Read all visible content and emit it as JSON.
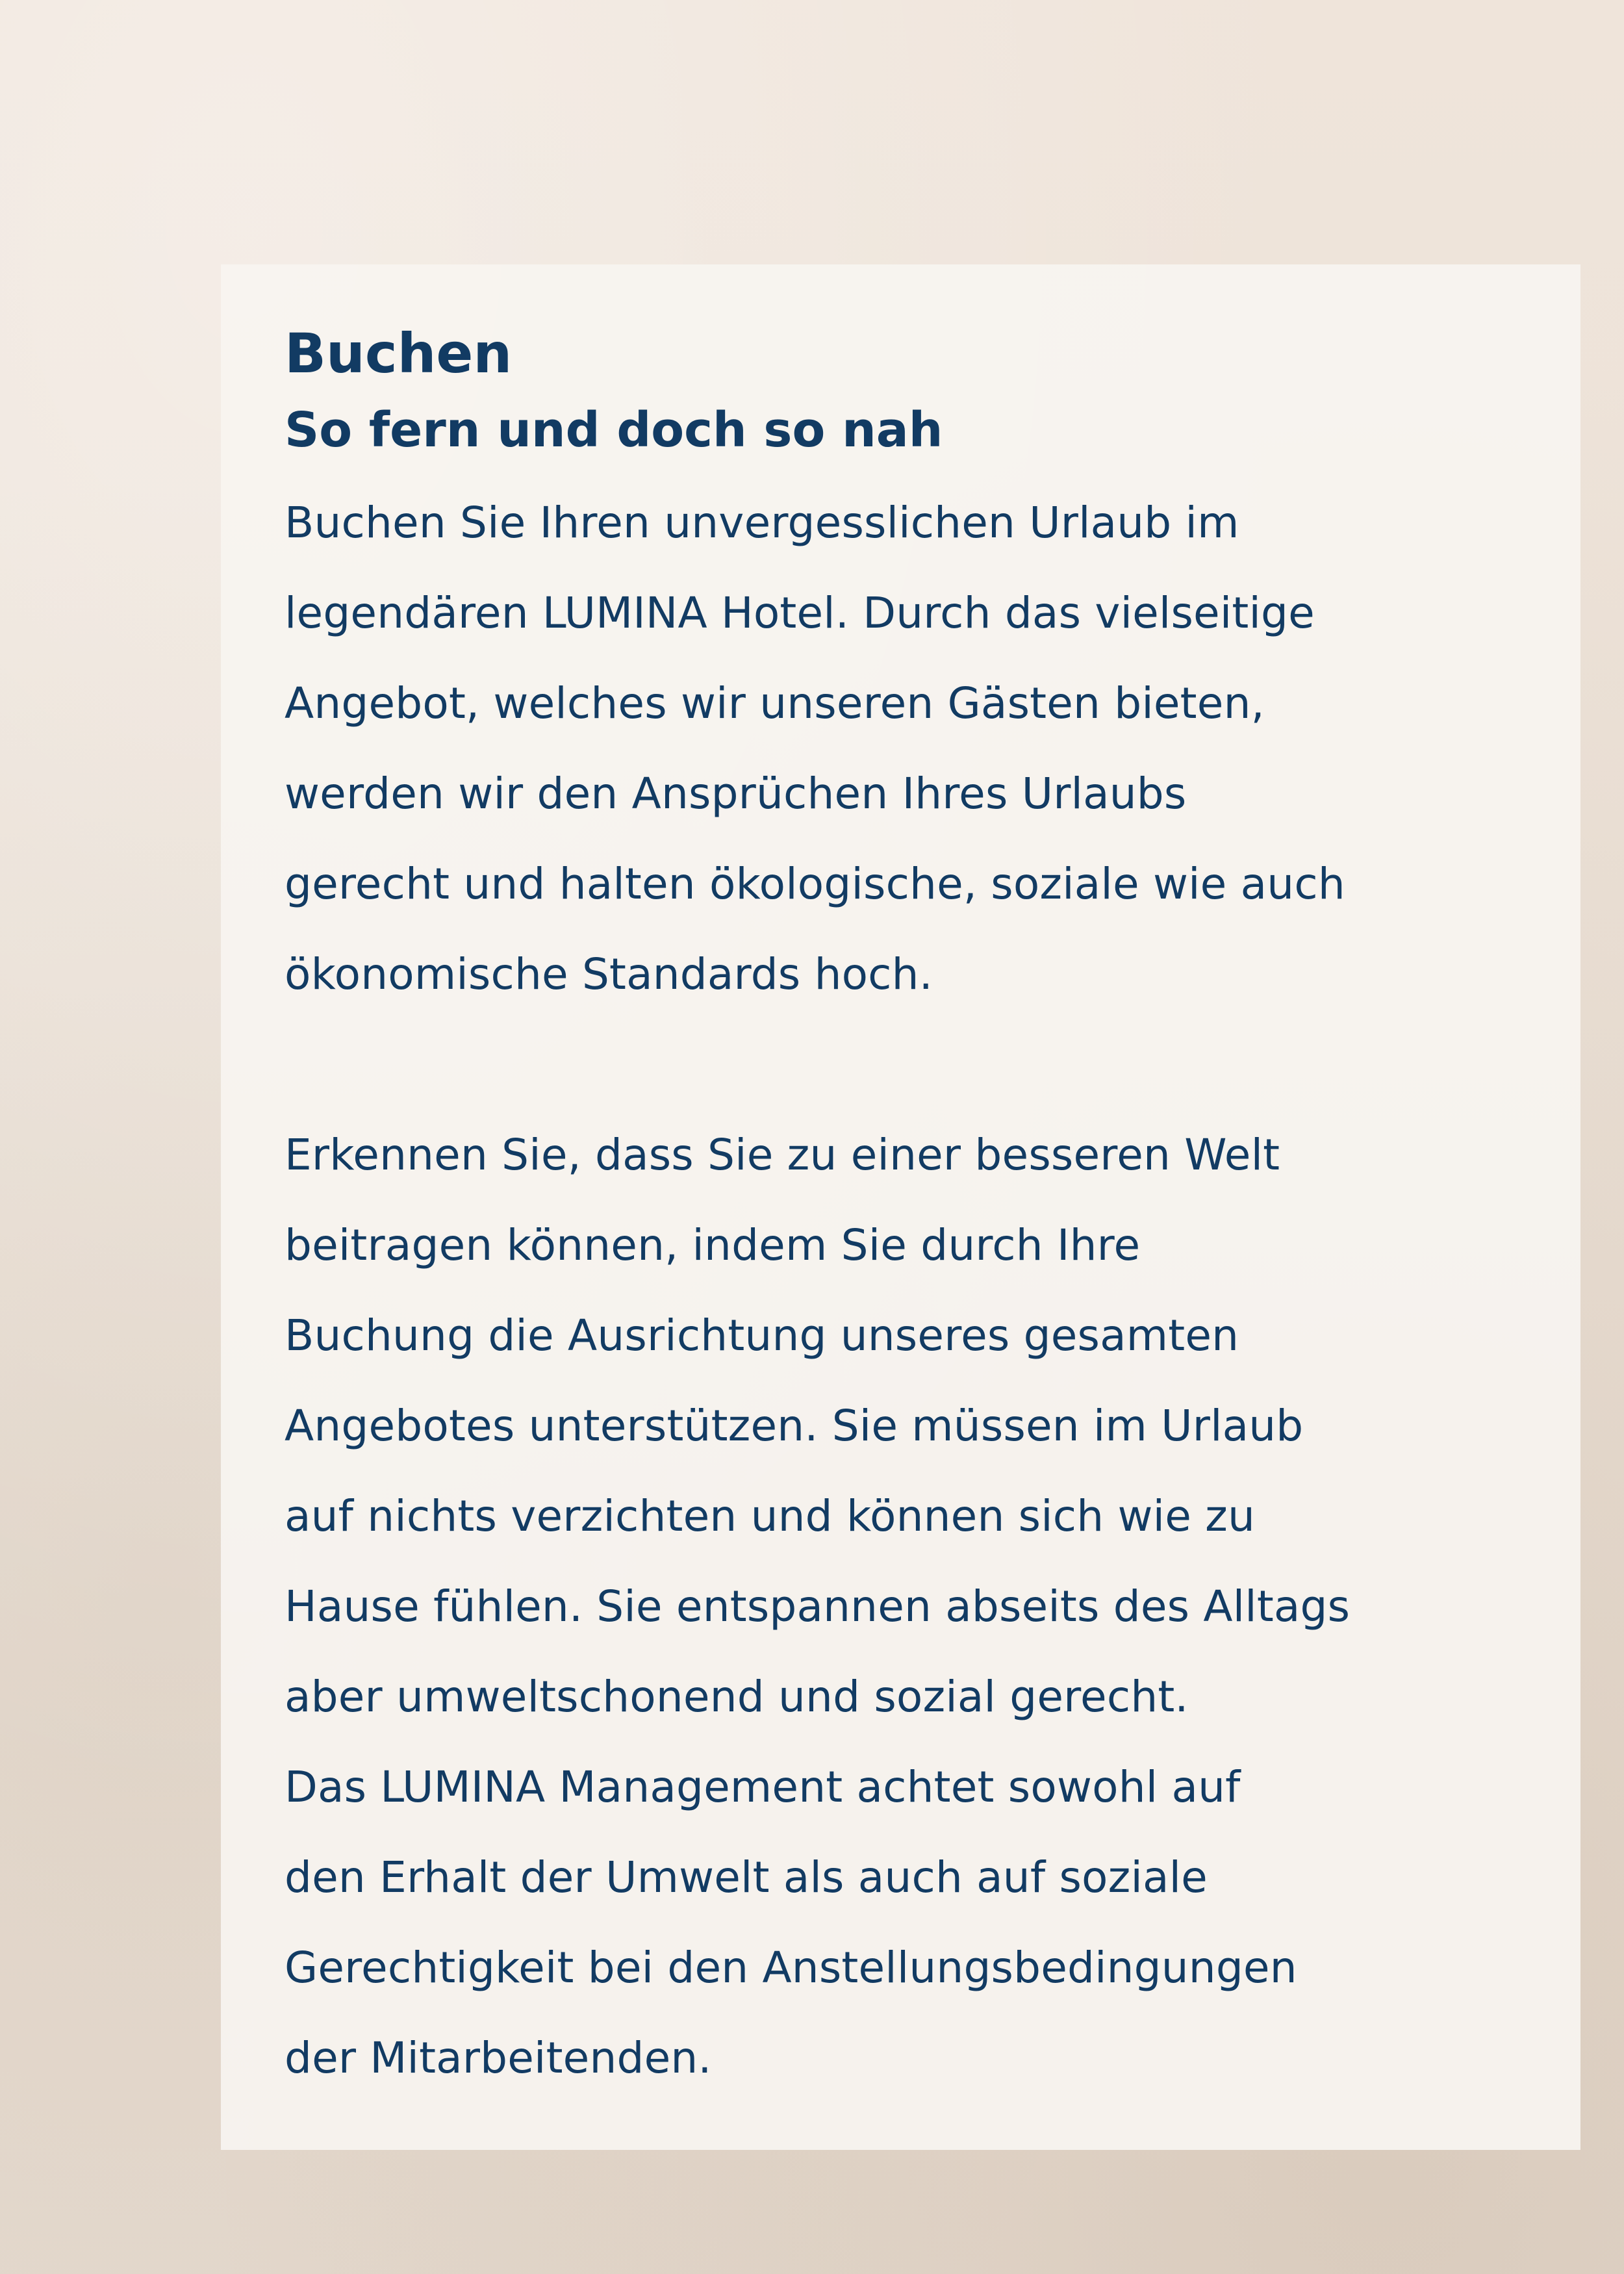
{
  "heading": "Buchen",
  "subheading": "So fern und doch so nah",
  "paragraph1": [
    "Buchen Sie Ihren unvergesslichen Urlaub im",
    "legendären LUMINA Hotel. Durch das vielseitige",
    "Angebot, welches wir unseren Gästen bieten,",
    "werden wir den Ansprüchen Ihres Urlaubs",
    "gerecht und halten ökologische, soziale wie auch",
    "ökonomische Standards hoch."
  ],
  "paragraph2": [
    "Erkennen Sie, dass Sie zu einer besseren Welt",
    "beitragen können, indem Sie durch Ihre",
    "Buchung die Ausrichtung unseres gesamten",
    "Angebotes unterstützen. Sie müssen im Urlaub",
    "auf nichts verzichten und können sich wie zu",
    "Hause fühlen. Sie entspannen abseits des Alltags",
    "aber umweltschonend und sozial gerecht.",
    "Das LUMINA Management achtet sowohl auf",
    "den Erhalt der Umwelt als auch auf soziale",
    "Gerechtigkeit bei den Anstellungsbedingungen",
    "der Mitarbeitenden."
  ]
}
